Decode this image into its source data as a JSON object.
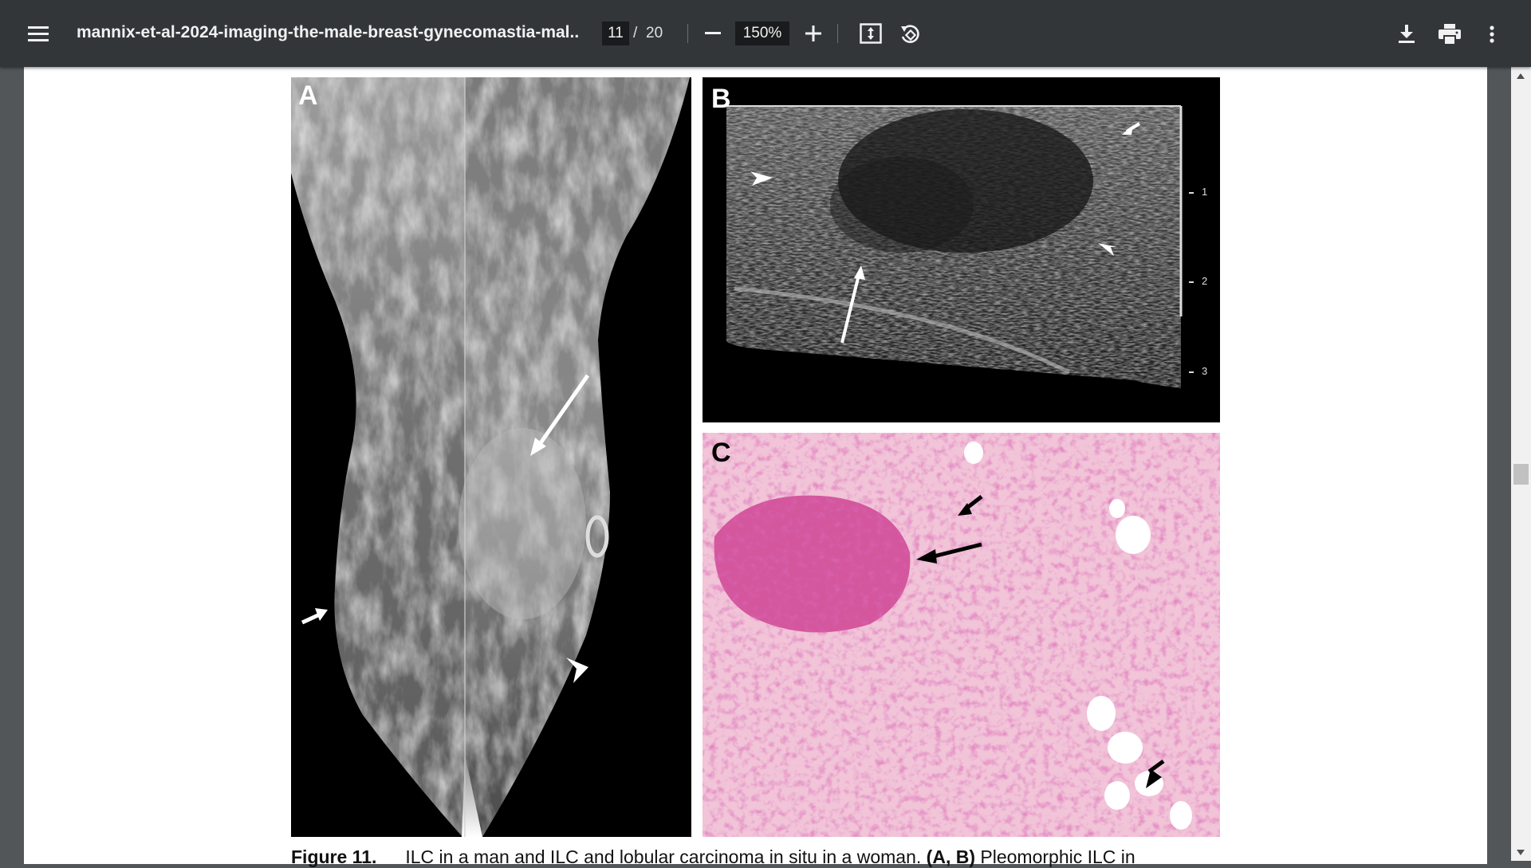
{
  "toolbar": {
    "menu_icon": "hamburger-menu-icon",
    "document_title": "mannix-et-al-2024-imaging-the-male-breast-gynecomastia-mal...",
    "current_page": "11",
    "page_separator": "/",
    "total_pages": "20",
    "zoom_out_icon": "minus-icon",
    "zoom_level": "150%",
    "zoom_in_icon": "plus-icon",
    "fit_icon": "fit-to-page-icon",
    "rotate_icon": "rotate-counterclockwise-icon",
    "download_icon": "download-icon",
    "print_icon": "print-icon",
    "more_icon": "more-vertical-icon"
  },
  "figure": {
    "panels": [
      {
        "letter": "A"
      },
      {
        "letter": "B",
        "scale_ticks": [
          "1",
          "2",
          "3"
        ]
      },
      {
        "letter": "C"
      }
    ],
    "caption": {
      "label": "Figure 11.",
      "text_start": "ILC in a man and ILC and lobular carcinoma in situ in a woman.",
      "bold_ref": "(A, B)",
      "text_end": "Pleomorphic ILC in"
    }
  },
  "colors": {
    "toolbar_bg": "#323639",
    "viewer_bg": "#525659",
    "page_bg": "#ffffff",
    "histology_pink": "#f1c4d8",
    "histology_purple": "#c0287e"
  }
}
